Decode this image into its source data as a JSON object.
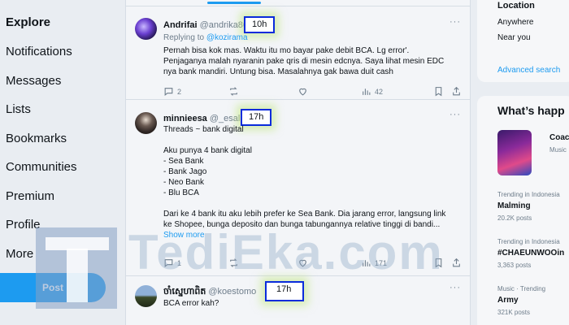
{
  "nav": {
    "items": [
      "Explore",
      "Notifications",
      "Messages",
      "Lists",
      "Bookmarks",
      "Communities",
      "Premium",
      "Profile",
      "More"
    ],
    "post_label": "Post"
  },
  "watermark": {
    "text": "TediEka.com"
  },
  "tweets": [
    {
      "name": "Andrifai",
      "handle": "@andrika86",
      "time": "10h",
      "reply_prefix": "Replying to ",
      "reply_to": "@kozirama",
      "lines": [
        "Pernah bisa kok mas. Waktu itu mo bayar pake debit BCA. Lg error'.",
        "Penjaganya malah nyaranin pake qris di mesin edcnya. Saya lihat mesin EDC",
        "nya bank mandiri. Untung bisa. Masalahnya gak bawa duit cash"
      ],
      "replies": "2",
      "reposts": "",
      "likes": "",
      "views": "42"
    },
    {
      "name": "minnieesa",
      "handle": "@_esalis",
      "time": "17h",
      "lines": [
        "Threads ~ bank digital",
        "",
        "Aku punya 4 bank digital",
        "- Sea Bank",
        "- Bank Jago",
        "- Neo Bank",
        "- Blu BCA",
        "",
        "Dari ke 4 bank itu aku lebih prefer ke Sea Bank. Dia jarang error, langsung link",
        "ke Shopee, bunga deposito dan bunga tabungannya relative tinggi di bandi..."
      ],
      "show_more": "Show more",
      "replies": "1",
      "reposts": "",
      "likes": "",
      "views": "171"
    },
    {
      "name": "ចាំស្នេហាពិត",
      "handle": "@koestomo",
      "time": "17h",
      "lines": [
        "BCA error kah?"
      ]
    }
  ],
  "right": {
    "location_title": "Location",
    "location_options": [
      "Anywhere",
      "Near you"
    ],
    "advanced_search": "Advanced search",
    "whats_happening": "What’s happ",
    "event_title": "Coac",
    "event_sub": "Music",
    "trends": [
      {
        "sub": "Trending in Indonesia",
        "name": "Malming",
        "count": "20.2K posts"
      },
      {
        "sub": "Trending in Indonesia",
        "name": "#CHAEUNWOOin",
        "count": "3,363 posts"
      },
      {
        "sub": "Music · Trending",
        "name": "Army",
        "count": "321K posts"
      }
    ]
  },
  "colors": {
    "accent": "#1d9bf0",
    "highlight_border": "#0a2bdc",
    "highlight_glow": "#bee678",
    "muted": "#6e7d8b"
  }
}
